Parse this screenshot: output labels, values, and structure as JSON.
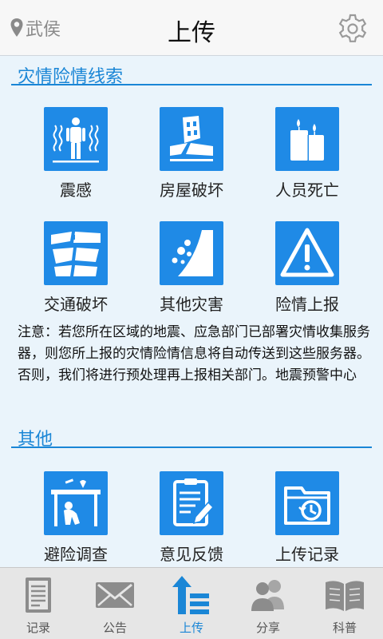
{
  "header": {
    "location": "武侯",
    "title": "上传"
  },
  "section1": {
    "title": "灾情险情线索",
    "items": [
      {
        "label": "震感",
        "icon": "tremor-person-icon"
      },
      {
        "label": "房屋破坏",
        "icon": "damaged-building-icon"
      },
      {
        "label": "人员死亡",
        "icon": "candles-icon"
      },
      {
        "label": "交通破坏",
        "icon": "broken-road-icon"
      },
      {
        "label": "其他灾害",
        "icon": "landslide-icon"
      },
      {
        "label": "险情上报",
        "icon": "warning-icon"
      }
    ]
  },
  "note": "注意：若您所在区域的地震、应急部门已部署灾情收集服务器，则您所上报的灾情险情信息将自动传送到这些服务器。否则，我们将进行预处理再上报相关部门。地震预警中心",
  "section2": {
    "title": "其他",
    "items": [
      {
        "label": "避险调查",
        "icon": "shelter-survey-icon"
      },
      {
        "label": "意见反馈",
        "icon": "feedback-clipboard-icon"
      },
      {
        "label": "上传记录",
        "icon": "upload-history-folder-icon"
      }
    ]
  },
  "tabs": [
    {
      "label": "记录",
      "icon": "document-icon",
      "active": false
    },
    {
      "label": "公告",
      "icon": "envelope-icon",
      "active": false
    },
    {
      "label": "上传",
      "icon": "upload-icon",
      "active": true
    },
    {
      "label": "分享",
      "icon": "users-icon",
      "active": false
    },
    {
      "label": "科普",
      "icon": "book-icon",
      "active": false
    }
  ],
  "colors": {
    "accent": "#1a86d6",
    "tile": "#1f8ae6",
    "background": "#eaf4fb"
  }
}
